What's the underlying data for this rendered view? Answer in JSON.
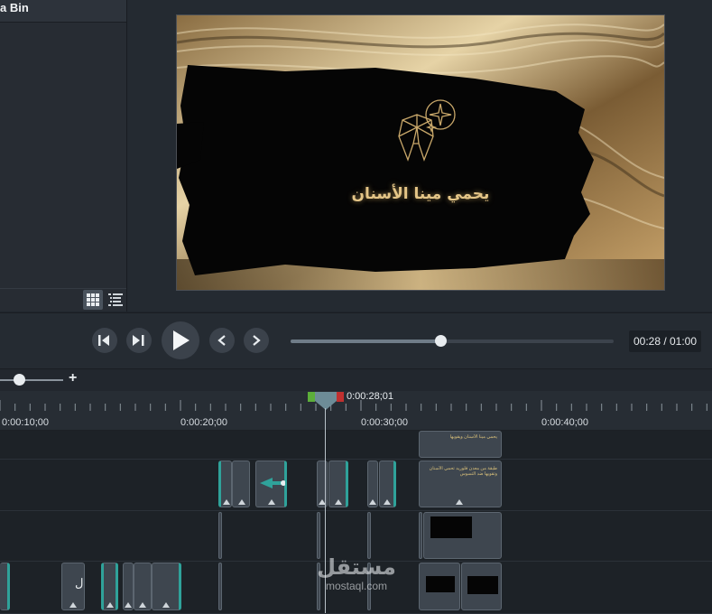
{
  "media_bin": {
    "title": "a Bin",
    "view_buttons": [
      {
        "name": "thumbnail-view",
        "icon": "grid-icon",
        "active": true
      },
      {
        "name": "details-view",
        "icon": "list-icon",
        "active": false
      }
    ]
  },
  "preview": {
    "caption": "يحمي مينا الأسنان",
    "logo_icon": "tooth-sparkle-icon"
  },
  "playback": {
    "buttons": [
      {
        "name": "step-backward-button",
        "icon": "step-backward-icon"
      },
      {
        "name": "step-forward-button",
        "icon": "step-forward-icon"
      },
      {
        "name": "play-button",
        "icon": "play-icon"
      },
      {
        "name": "previous-frame-button",
        "icon": "chevron-left-icon"
      },
      {
        "name": "next-frame-button",
        "icon": "chevron-right-icon"
      }
    ],
    "progress": 0.465,
    "timecode": "00:28 / 01:00"
  },
  "timeline": {
    "zoom_plus": "+",
    "zoom_level": 0.3,
    "playhead_time": "0:00:28;01",
    "ruler_labels": [
      "0:00:10;00",
      "0:00:20;00",
      "0:00:30;00",
      "0:00:40;00"
    ],
    "clip_text": {
      "callout_1": "يحمي مينا الأسنان ويقويها",
      "callout_2": "طبقة من معدن فلوريد تحمي الأسنان وتقويها ضد التسوس"
    },
    "track_glyph": "ل"
  },
  "watermark": {
    "brand": "مستقل",
    "url": "mostaql.com"
  },
  "colors": {
    "accent_teal": "#2fa29a",
    "gold": "#c9a86a",
    "playhead_green": "#5cae3a",
    "playhead_red": "#c0302f"
  }
}
